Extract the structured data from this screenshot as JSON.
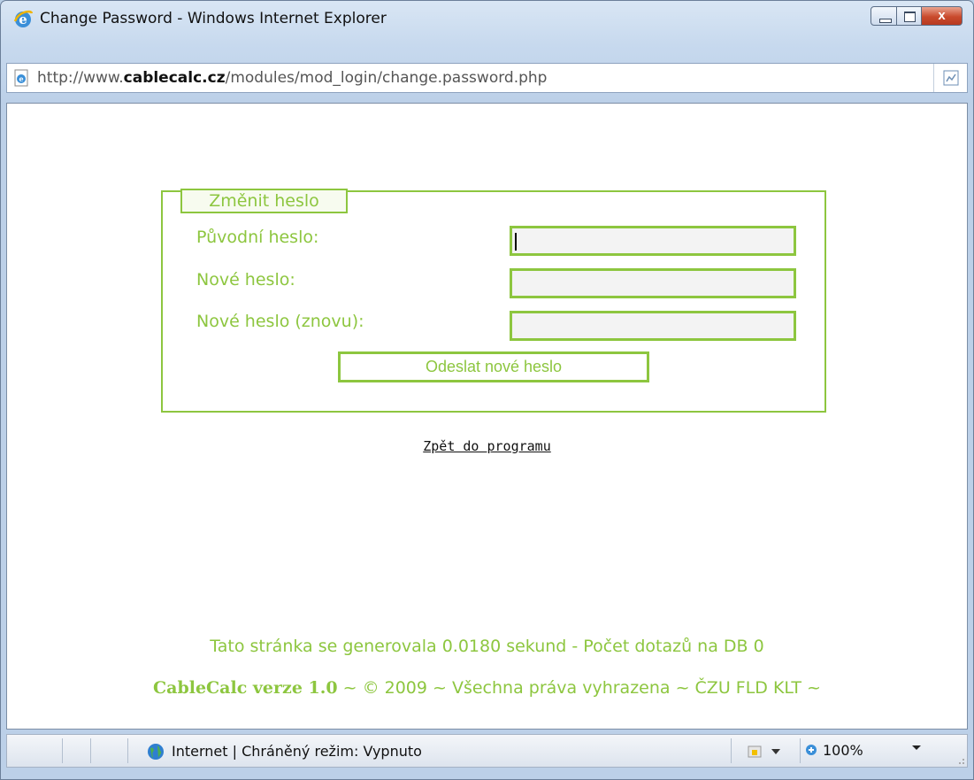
{
  "window": {
    "title": "Change Password - Windows Internet Explorer",
    "close_label": "x"
  },
  "address": {
    "prefix": "http://www.",
    "domain": "cablecalc.cz",
    "path": "/modules/mod_login/change.password.php"
  },
  "form": {
    "legend": "Změnit heslo",
    "fields": [
      {
        "label": "Původní heslo:",
        "value": ""
      },
      {
        "label": "Nové heslo:",
        "value": ""
      },
      {
        "label": "Nové heslo (znovu):",
        "value": ""
      }
    ],
    "submit_label": "Odeslat nové heslo"
  },
  "back_link": "Zpět do programu",
  "footer": {
    "generated": "Tato stránka se generovala 0.0180 sekund - Počet dotazů na DB 0",
    "brand": "CableCalc verze 1.0",
    "rights": " ~ © 2009 ~ Všechna práva vyhrazena ~ ČZU FLD KLT ~"
  },
  "status": {
    "zone": "Internet | Chráněný režim: Vypnuto",
    "zoom": "100%"
  },
  "colors": {
    "accent": "#8dc63f",
    "input_bg": "#f3f3f3"
  },
  "icons": [
    "ie-logo-icon",
    "page-icon",
    "rss-icon",
    "globe-icon",
    "addons-icon",
    "zoom-icon"
  ]
}
